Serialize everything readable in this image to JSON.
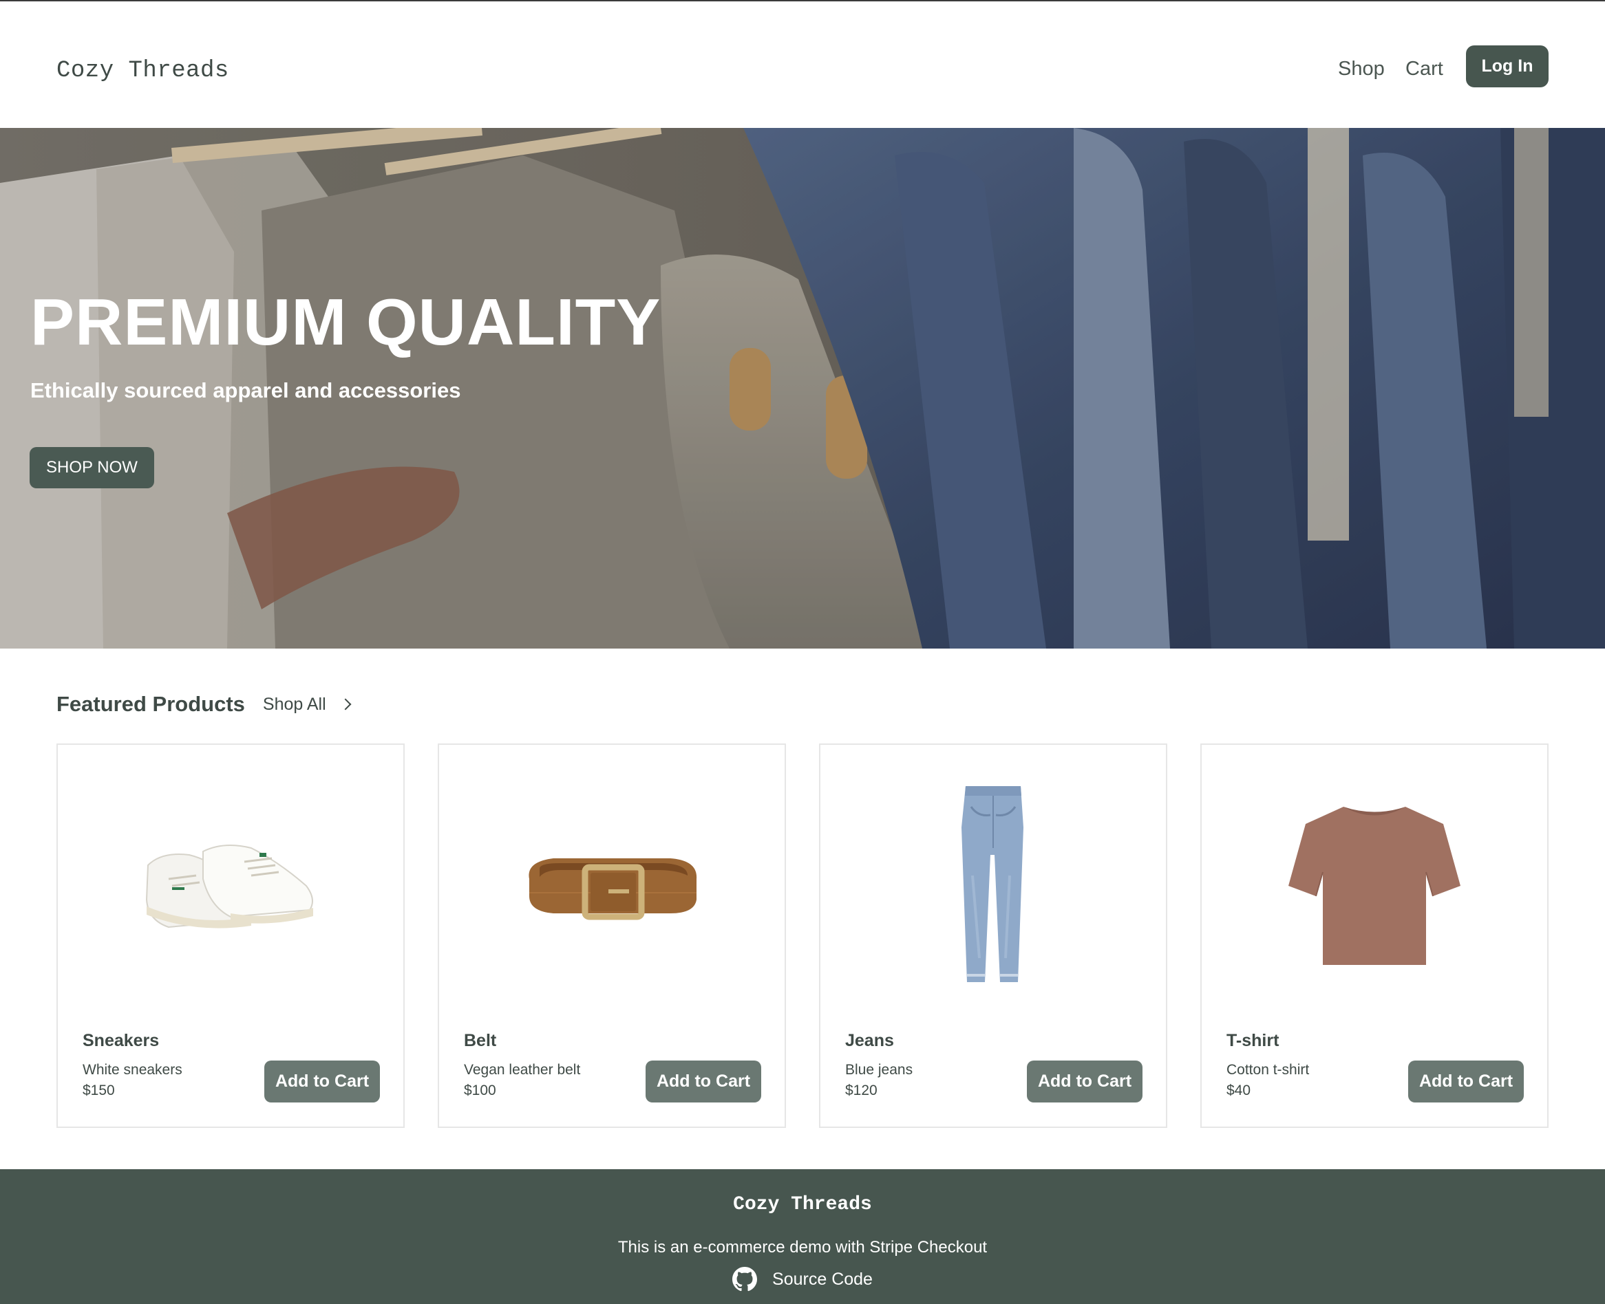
{
  "header": {
    "logo": "Cozy Threads",
    "nav": [
      {
        "label": "Shop"
      },
      {
        "label": "Cart"
      }
    ],
    "login_label": "Log In"
  },
  "hero": {
    "title": "PREMIUM QUALITY",
    "subtitle": "Ethically sourced apparel and accessories",
    "cta_label": "SHOP NOW"
  },
  "featured": {
    "title": "Featured Products",
    "shop_all_label": "Shop All",
    "products": [
      {
        "name": "Sneakers",
        "description": "White sneakers",
        "price": "$150",
        "button": "Add to Cart",
        "icon": "sneakers-image"
      },
      {
        "name": "Belt",
        "description": "Vegan leather belt",
        "price": "$100",
        "button": "Add to Cart",
        "icon": "belt-image"
      },
      {
        "name": "Jeans",
        "description": "Blue jeans",
        "price": "$120",
        "button": "Add to Cart",
        "icon": "jeans-image"
      },
      {
        "name": "T-shirt",
        "description": "Cotton t-shirt",
        "price": "$40",
        "button": "Add to Cart",
        "icon": "tshirt-image"
      }
    ]
  },
  "footer": {
    "logo": "Cozy Threads",
    "text": "This is an e-commerce demo with Stripe Checkout",
    "source_label": "Source Code",
    "icon": "github-icon"
  },
  "colors": {
    "primary": "#47564f",
    "button_muted": "#6a7872",
    "text": "#3f4a46"
  }
}
